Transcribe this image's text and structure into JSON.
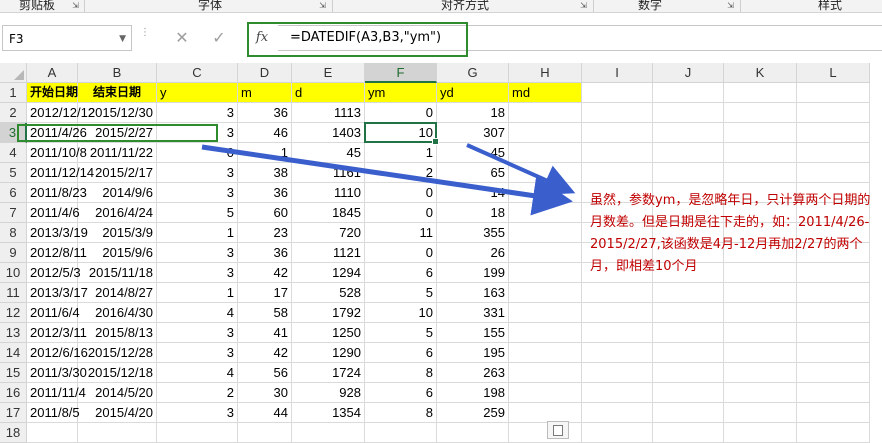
{
  "ribbon": {
    "groups": [
      "剪贴板",
      "字体",
      "对齐方式",
      "数字",
      "样式"
    ]
  },
  "formula_bar": {
    "name_box": "F3",
    "cancel_icon": "✕",
    "enter_icon": "✓",
    "fx_label": "fx",
    "formula": "=DATEDIF(A3,B3,\"ym\")"
  },
  "columns": [
    "A",
    "B",
    "C",
    "D",
    "E",
    "F",
    "G",
    "H",
    "I",
    "J",
    "K",
    "L"
  ],
  "row_numbers": [
    "1",
    "2",
    "3",
    "4",
    "5",
    "6",
    "7",
    "8",
    "9",
    "10",
    "11",
    "12",
    "13",
    "14",
    "15",
    "16",
    "17",
    "18"
  ],
  "header_row": {
    "a": "开始日期",
    "b": "结束日期",
    "c": "y",
    "d": "m",
    "e": "d",
    "f": "ym",
    "g": "yd",
    "h": "md"
  },
  "rows": [
    [
      "2012/12/12",
      "2015/12/30",
      "3",
      "36",
      "1113",
      "0",
      "18"
    ],
    [
      "2011/4/26",
      "2015/2/27",
      "3",
      "46",
      "1403",
      "10",
      "307"
    ],
    [
      "2011/10/8",
      "2011/11/22",
      "0",
      "1",
      "45",
      "1",
      "45"
    ],
    [
      "2011/12/14",
      "2015/2/17",
      "3",
      "38",
      "1161",
      "2",
      "65"
    ],
    [
      "2011/8/23",
      "2014/9/6",
      "3",
      "36",
      "1110",
      "0",
      "14"
    ],
    [
      "2011/4/6",
      "2016/4/24",
      "5",
      "60",
      "1845",
      "0",
      "18"
    ],
    [
      "2013/3/19",
      "2015/3/9",
      "1",
      "23",
      "720",
      "11",
      "355"
    ],
    [
      "2012/8/11",
      "2015/9/6",
      "3",
      "36",
      "1121",
      "0",
      "26"
    ],
    [
      "2012/5/3",
      "2015/11/18",
      "3",
      "42",
      "1294",
      "6",
      "199"
    ],
    [
      "2013/3/17",
      "2014/8/27",
      "1",
      "17",
      "528",
      "5",
      "163"
    ],
    [
      "2011/6/4",
      "2016/4/30",
      "4",
      "58",
      "1792",
      "10",
      "331"
    ],
    [
      "2012/3/11",
      "2015/8/13",
      "3",
      "41",
      "1250",
      "5",
      "155"
    ],
    [
      "2012/6/16",
      "2015/12/28",
      "3",
      "42",
      "1290",
      "6",
      "195"
    ],
    [
      "2011/3/30",
      "2015/12/18",
      "4",
      "56",
      "1724",
      "8",
      "263"
    ],
    [
      "2011/11/4",
      "2014/5/20",
      "2",
      "30",
      "928",
      "6",
      "198"
    ],
    [
      "2011/8/5",
      "2015/4/20",
      "3",
      "44",
      "1354",
      "8",
      "259"
    ]
  ],
  "annotation": "虽然，参数ym，是忽略年日，只计算两个日期的月数差。但是日期是往下走的，如：2011/4/26-2015/2/27,该函数是4月-12月再加2/27的两个月，即相差10个月",
  "colors": {
    "accent_green": "#217346",
    "highlight_box": "#2e8b2e",
    "arrow": "#3a5fcd",
    "annotation_text": "#c00000",
    "header_fill": "#ffff00"
  }
}
